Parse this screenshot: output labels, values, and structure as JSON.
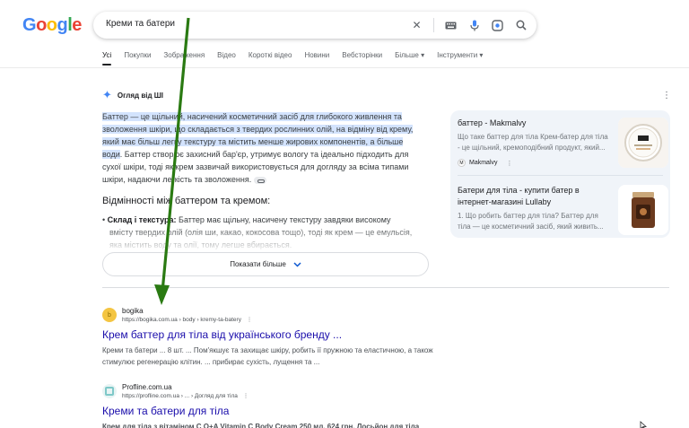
{
  "logo": {
    "letters": [
      "G",
      "o",
      "o",
      "g",
      "l",
      "e"
    ],
    "colors": [
      "#4285f4",
      "#ea4335",
      "#fbbc05",
      "#4285f4",
      "#34a853",
      "#ea4335"
    ]
  },
  "search": {
    "query": "Креми та батери"
  },
  "tabs": [
    "Усі",
    "Покупки",
    "Зображення",
    "Відео",
    "Короткі відео",
    "Новини",
    "Вебсторінки",
    "Більше",
    "Інструменти"
  ],
  "ai": {
    "heading": "Огляд від ШІ",
    "p1_highlight": "Баттер — це щільний, насичений косметичний засіб для глибокого живлення та зволоження шкіри, що складається з твердих рослинних олій, на відміну від крему, який має більш легку текстуру та містить менше жирових компонентів, а більше води",
    "p1_rest": ". Баттер створює захисний бар'єр, утримує вологу та ідеально підходить для сухої шкіри, тоді як крем зазвичай використовується для догляду за всіма типами шкіри, надаючи легкість та зволоження.",
    "subheading": "Відмінності між баттером та кремом:",
    "bullet_label": "Склад і текстура:",
    "bullet_text": " Баттер має щільну, насичену текстуру завдяки високому вмісту твердих олій (олія ши, какао, кокосова тощо), тоді як крем — це емульсія, яка містить воду та олії, тому легше вбирається.",
    "show_more": "Показати більше"
  },
  "side_cards": [
    {
      "title": "баттер - Makmalvy",
      "snippet": "Що таке баттер для тіла Крем-батер для тіла - це щільний, кремоподібний продукт, який...",
      "source": "Makmalvy"
    },
    {
      "title": "Батери для тіла - купити батер в інтернет-магазині Lullaby",
      "snippet": "1. Що робить баттер для тіла? Баттер для тіла — це косметичний засіб, який живить...",
      "source": ""
    }
  ],
  "results": [
    {
      "site": "bogika",
      "url": "https://bogika.com.ua › body › kremy-ta-batery",
      "title": "Крем баттер для тіла від українського бренду ...",
      "snippet": "Креми та батери ... 8 шт. ... Пом'якшує та захищає шкіру, робить її пружною та еластичною, а також стимулює регенерацію клітин. ... прибирає сухість, лущення та ...",
      "favicon_color": "#f4c542"
    },
    {
      "site": "Profline.com.ua",
      "url": "https://profline.com.ua › ... › Догляд для тіла",
      "title": "Креми та батери для тіла",
      "snippet": "Крем для тіла з вітаміном С Q+A Vitamin C Body Cream 250 мл. 624 грн. Лосьйон для тіла",
      "favicon_color": "#7ec8c8"
    }
  ],
  "colors": {
    "arrow": "#2a7a12",
    "link": "#1a0dab",
    "highlight": "#d3e3fd"
  }
}
